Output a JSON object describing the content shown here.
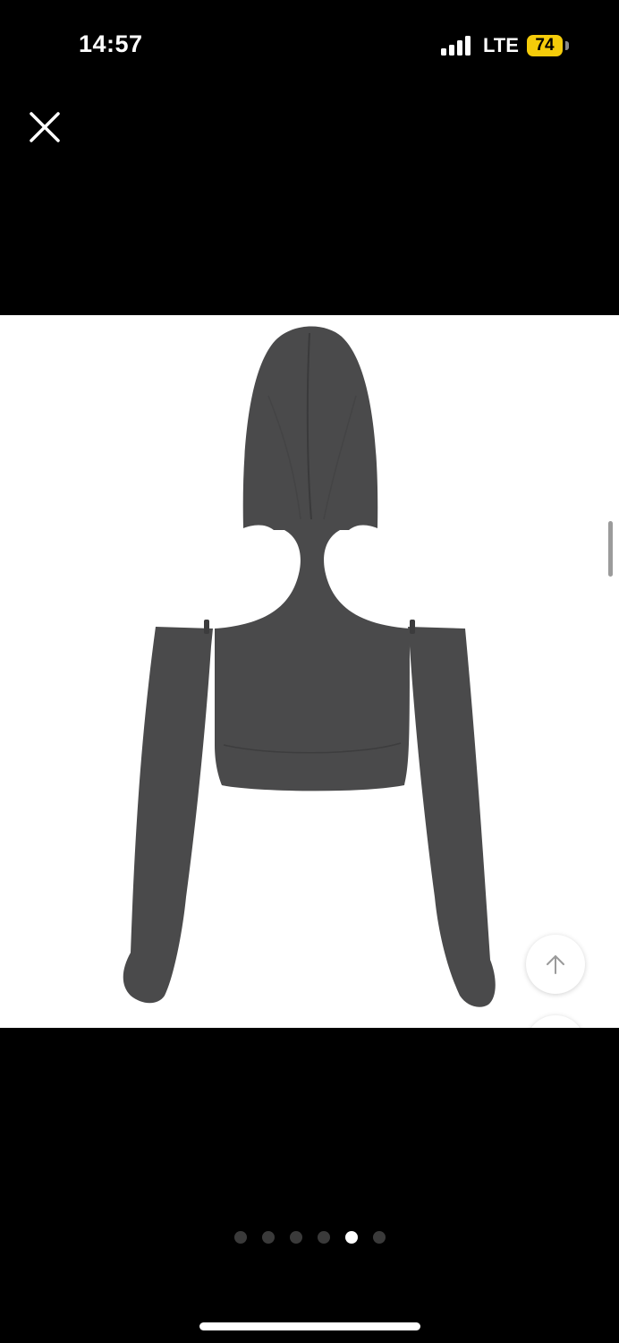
{
  "status_bar": {
    "time": "14:57",
    "network": "LTE",
    "battery": "74"
  },
  "icons": {
    "close": "close-icon",
    "arrow_up": "arrow-up-icon",
    "signal": "signal-icon",
    "battery": "battery-icon"
  },
  "colors": {
    "background": "#000000",
    "image_background": "#ffffff",
    "garment": "#4a4a4b",
    "battery": "#f5cc0a",
    "dot_inactive": "#3a3a3a",
    "dot_active": "#ffffff"
  },
  "gallery": {
    "total_images": 6,
    "active_index": 4
  }
}
